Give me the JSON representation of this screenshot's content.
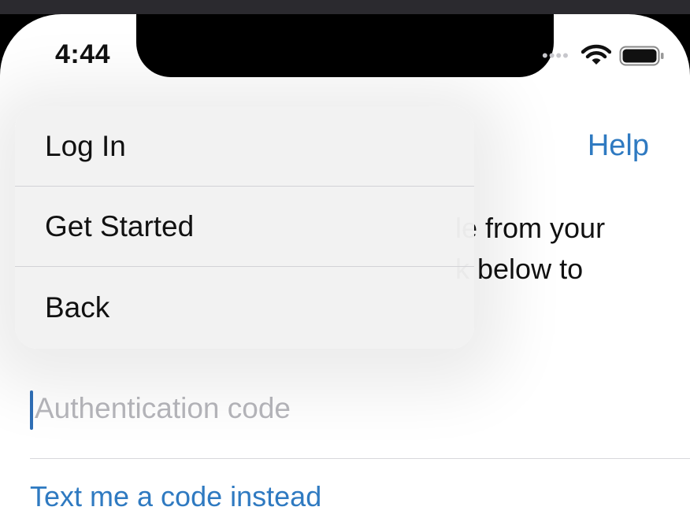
{
  "status_bar": {
    "time": "4:44",
    "signal": "••••",
    "wifi_icon": "wifi-icon",
    "battery_icon": "battery-icon"
  },
  "header": {
    "help_label": "Help"
  },
  "main": {
    "instructions_visible": "le from your\nk below to",
    "auth_field": {
      "value": "",
      "placeholder": "Authentication code"
    },
    "text_code_link": "Text me a code instead"
  },
  "menu": {
    "items": [
      {
        "label": "Log In"
      },
      {
        "label": "Get Started"
      },
      {
        "label": "Back"
      }
    ]
  },
  "colors": {
    "accent": "#2f7ac1",
    "caret": "#2f6fb6",
    "menu_bg": "#f2f2f2"
  }
}
